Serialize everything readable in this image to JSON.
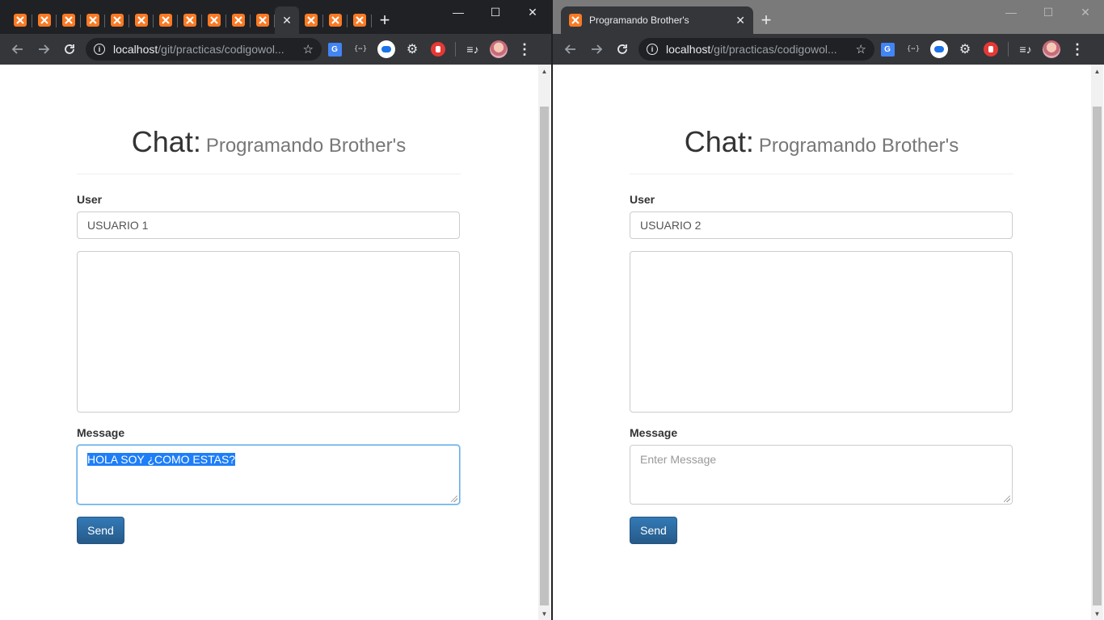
{
  "left_window": {
    "tab_count_before_active": 11,
    "tab_count_after_active": 3,
    "active_tab_close": "✕",
    "new_tab": "+",
    "controls": {
      "minimize": "—",
      "maximize": "☐",
      "close": "✕"
    },
    "address": {
      "host": "localhost",
      "path": "/git/practicas/codigowol..."
    },
    "page": {
      "title": "Chat:",
      "subtitle": "Programando Brother's",
      "user_label": "User",
      "user_value": "USUARIO 1",
      "message_label": "Message",
      "message_value": "HOLA SOY ¿COMO ESTAS?",
      "send_label": "Send"
    }
  },
  "right_window": {
    "tab_title": "Programando Brother's",
    "tab_close": "✕",
    "new_tab": "+",
    "controls": {
      "minimize": "—",
      "maximize": "☐",
      "close": "✕"
    },
    "address": {
      "host": "localhost",
      "path": "/git/practicas/codigowol..."
    },
    "page": {
      "title": "Chat:",
      "subtitle": "Programando Brother's",
      "user_label": "User",
      "user_value": "USUARIO 2",
      "message_label": "Message",
      "message_placeholder": "Enter Message",
      "send_label": "Send"
    }
  },
  "colors": {
    "xampp_orange": "#fb7a24",
    "chrome_dark": "#202124",
    "chrome_toolbar": "#35363a",
    "button_primary": "#337ab7",
    "selection": "#1e7ef8"
  },
  "icons": [
    "back-icon",
    "forward-icon",
    "reload-icon",
    "info-icon",
    "star-icon",
    "translate-icon",
    "json-icon",
    "owl-icon",
    "gear-icon",
    "stop-icon",
    "playlist-icon",
    "avatar",
    "menu-icon",
    "xampp-icon"
  ]
}
